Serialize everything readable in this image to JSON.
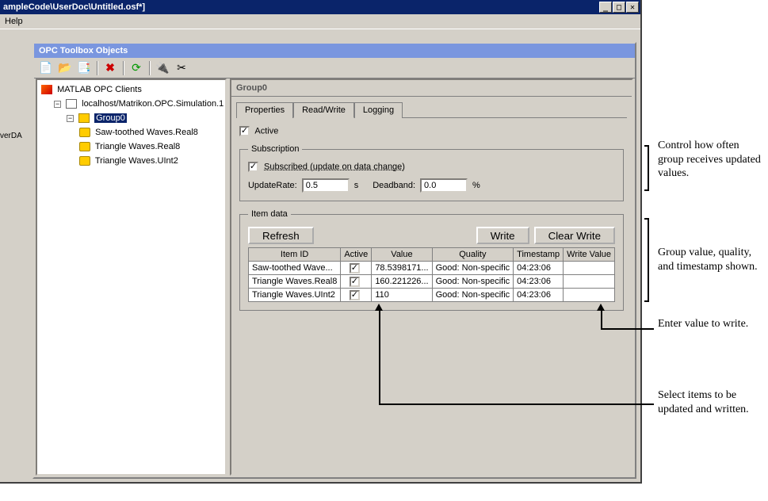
{
  "outer": {
    "title": "ampleCode\\UserDoc\\Untitled.osf*]",
    "menu_help": "Help"
  },
  "left_gutter_text": "verDA",
  "inner": {
    "title": "OPC Toolbox Objects"
  },
  "tree": {
    "root": "MATLAB OPC Clients",
    "host": "localhost/Matrikon.OPC.Simulation.1",
    "group": "Group0",
    "items": [
      "Saw-toothed Waves.Real8",
      "Triangle Waves.Real8",
      "Triangle Waves.UInt2"
    ]
  },
  "detail": {
    "header": "Group0",
    "tabs": {
      "properties": "Properties",
      "readwrite": "Read/Write",
      "logging": "Logging"
    },
    "active_label": "Active"
  },
  "subscription": {
    "legend": "Subscription",
    "subscribed_label": "Subscribed (update on data change)",
    "updaterate_label": "UpdateRate:",
    "updaterate_value": "0.5",
    "seconds": "s",
    "deadband_label": "Deadband:",
    "deadband_value": "0.0",
    "percent": "%"
  },
  "itemdata": {
    "legend": "Item data",
    "refresh": "Refresh",
    "write": "Write",
    "clear": "Clear Write",
    "headers": {
      "item": "Item ID",
      "active": "Active",
      "value": "Value",
      "quality": "Quality",
      "timestamp": "Timestamp",
      "writeval": "Write Value"
    },
    "rows": [
      {
        "id": "Saw-toothed Wave...",
        "active": true,
        "value": "78.5398171...",
        "quality": "Good: Non-specific",
        "timestamp": "04:23:06",
        "write": ""
      },
      {
        "id": "Triangle Waves.Real8",
        "active": true,
        "value": "160.221226...",
        "quality": "Good: Non-specific",
        "timestamp": "04:23:06",
        "write": ""
      },
      {
        "id": "Triangle Waves.UInt2",
        "active": true,
        "value": "110",
        "quality": "Good: Non-specific",
        "timestamp": "04:23:06",
        "write": ""
      }
    ]
  },
  "annotations": {
    "a1": "Control how often group receives updated values.",
    "a2": "Group value, quality, and timestamp shown.",
    "a3": "Enter value to write.",
    "a4": "Select items to be updated and written."
  },
  "chart_data": {
    "type": "table",
    "title": "Item data",
    "columns": [
      "Item ID",
      "Active",
      "Value",
      "Quality",
      "Timestamp",
      "Write Value"
    ],
    "rows": [
      [
        "Saw-toothed Wave...",
        true,
        "78.5398171...",
        "Good: Non-specific",
        "04:23:06",
        ""
      ],
      [
        "Triangle Waves.Real8",
        true,
        "160.221226...",
        "Good: Non-specific",
        "04:23:06",
        ""
      ],
      [
        "Triangle Waves.UInt2",
        true,
        "110",
        "Good: Non-specific",
        "04:23:06",
        ""
      ]
    ]
  }
}
